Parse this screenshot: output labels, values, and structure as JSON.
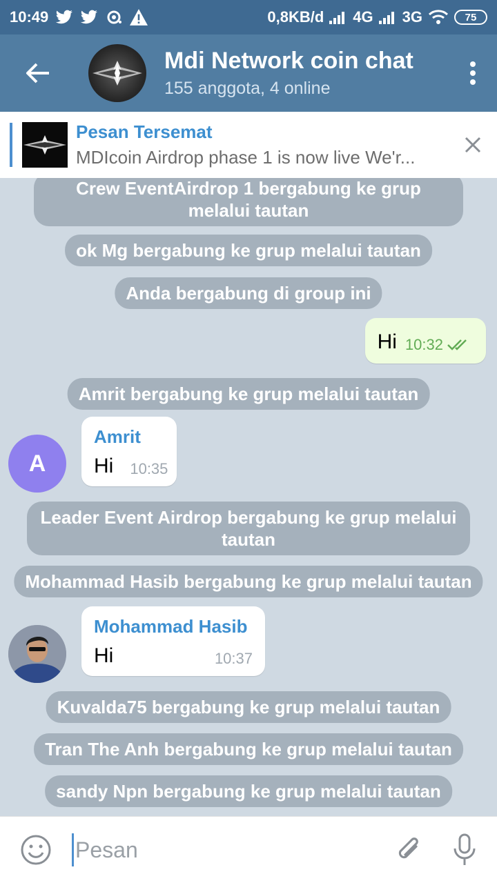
{
  "status_bar": {
    "time": "10:49",
    "speed": "0,8KB/d",
    "net1": "4G",
    "net2": "3G",
    "battery": "75"
  },
  "header": {
    "title": "Mdi Network coin chat",
    "subtitle": "155 anggota, 4 online"
  },
  "pinned": {
    "title": "Pesan Tersemat",
    "text": "MDIcoin Airdrop phase 1 is now live We'r..."
  },
  "messages": {
    "svc1": "Crew EventAirdrop 1 bergabung ke grup melalui tautan",
    "svc2": "ok Mg bergabung ke grup melalui tautan",
    "svc3": "Anda bergabung di group ini",
    "out1": {
      "text": "Hi",
      "time": "10:32"
    },
    "svc4": "Amrit bergabung ke grup melalui tautan",
    "in1": {
      "sender": "Amrit",
      "avatar_letter": "A",
      "text": "Hi",
      "time": "10:35"
    },
    "svc5": "Leader Event Airdrop bergabung ke grup melalui tautan",
    "svc6": "Mohammad Hasib bergabung ke grup melalui tautan",
    "in2": {
      "sender": "Mohammad Hasib",
      "text": "Hi",
      "time": "10:37"
    },
    "svc7": "Kuvalda75 bergabung ke grup melalui tautan",
    "svc8": "Tran The Anh bergabung ke grup melalui tautan",
    "svc9": "sandy Npn bergabung ke grup melalui tautan"
  },
  "input": {
    "placeholder": "Pesan"
  },
  "colors": {
    "header": "#517da2",
    "status_bar": "#3f6a92",
    "chat_bg": "#cfd9e2",
    "out_bubble": "#effdde",
    "link_blue": "#3d8fd0",
    "avatar_a": "#8f80ee"
  }
}
